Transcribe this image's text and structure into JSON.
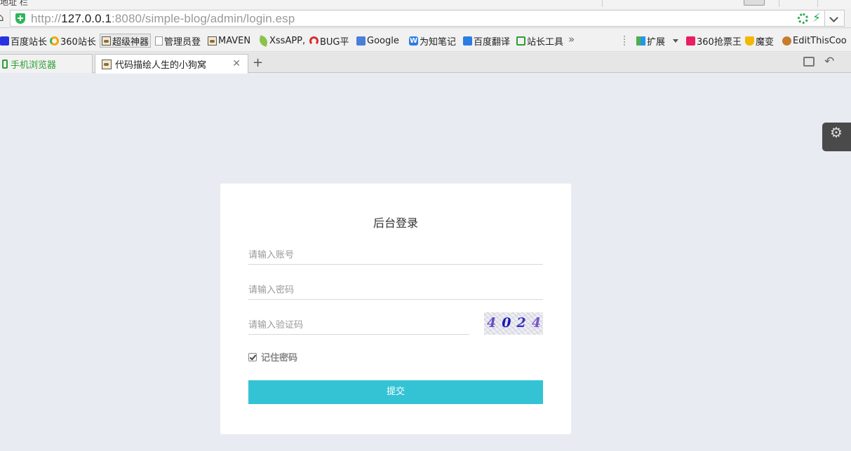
{
  "browser": {
    "top_fragment": "地址 栏",
    "url": {
      "scheme": "http://",
      "host": "127.0.0.1",
      "rest": ":8080/simple-blog/admin/login.esp"
    },
    "bookmarks": [
      {
        "label": "百度站长",
        "icon": "baidu-paw-icon",
        "color": "#2932e1"
      },
      {
        "label": "360站长",
        "icon": "ring-icon",
        "color": "#f0a800"
      },
      {
        "label": "超级神器",
        "icon": "dog-icon",
        "color": "#8a6b3b"
      },
      {
        "label": "管理员登",
        "icon": "page-icon",
        "color": "#999999"
      },
      {
        "label": "MAVEN",
        "icon": "dog-icon",
        "color": "#8a6b3b"
      },
      {
        "label": "XssAPP,",
        "icon": "leaf-icon",
        "color": "#8bc34a"
      },
      {
        "label": "BUG平",
        "icon": "arc-icon",
        "color": "#d32f2f"
      },
      {
        "label": "Google",
        "icon": "translate-icon",
        "color": "#4a7fd8"
      },
      {
        "label": "为知笔记",
        "icon": "wiz-icon",
        "color": "#2a7de1"
      },
      {
        "label": "百度翻译",
        "icon": "translate-box-icon",
        "color": "#2a7de1"
      },
      {
        "label": "站长工具",
        "icon": "chart-icon",
        "color": "#2d9e33"
      }
    ],
    "more_bookmarks": "»",
    "extras": [
      {
        "label": "扩展",
        "icon": "apps-icon",
        "color": "#4caf50"
      },
      {
        "label": "360抢票王",
        "icon": "ticket-icon",
        "color": "#e91e63"
      },
      {
        "label": "魔变",
        "icon": "shield-yellow-icon",
        "color": "#f5b800"
      },
      {
        "label": "EditThisCoo",
        "icon": "cookie-icon",
        "color": "#c77c2e"
      }
    ],
    "tabs": [
      {
        "label": "手机浏览器"
      },
      {
        "label": "代码描绘人生的小狗窝"
      }
    ]
  },
  "login": {
    "title": "后台登录",
    "username_placeholder": "请输入账号",
    "password_placeholder": "请输入密码",
    "captcha_placeholder": "请输入验证码",
    "captcha_digits": [
      "4",
      "0",
      "2",
      "4"
    ],
    "remember_label": "记住密码",
    "remember_checked": true,
    "submit_label": "提交"
  },
  "colors": {
    "page_bg": "#e9ebf2",
    "submit_bg": "#34c3d4",
    "tab_accent": "#2d9e33"
  }
}
